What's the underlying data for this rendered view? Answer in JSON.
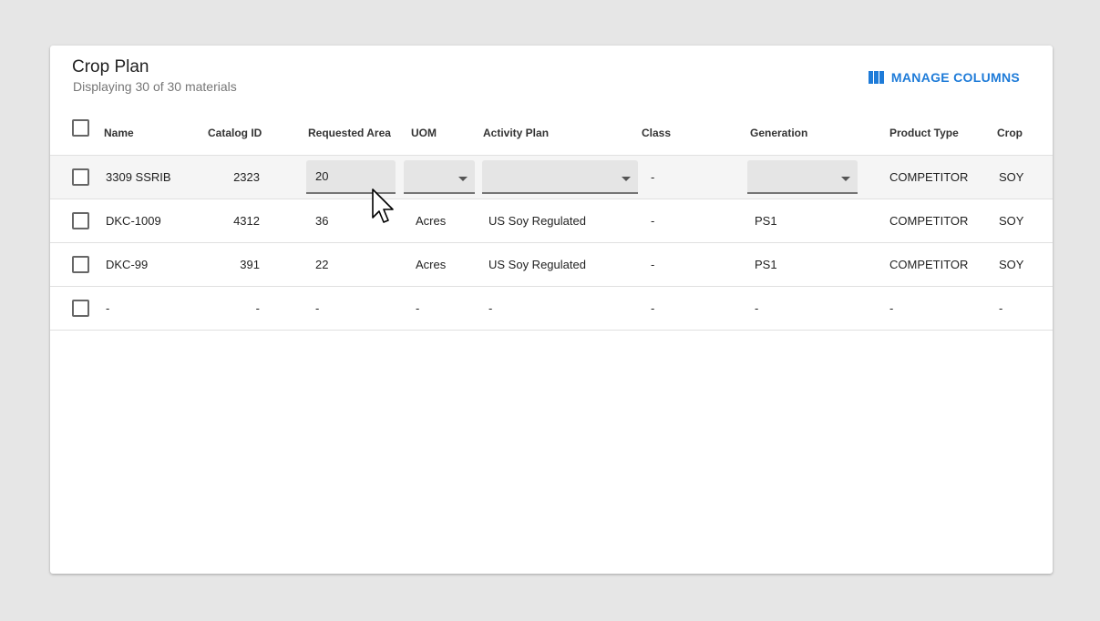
{
  "header": {
    "title": "Crop Plan",
    "subtitle": "Displaying 30 of 30 materials",
    "manage_columns_label": "MANAGE COLUMNS"
  },
  "columns": [
    "Name",
    "Catalog ID",
    "Requested Area",
    "UOM",
    "Activity Plan",
    "Class",
    "Generation",
    "Product Type",
    "Crop"
  ],
  "rows": [
    {
      "name": "3309 SSRIB",
      "catalog_id": "2323",
      "requested_area": "20",
      "uom": "",
      "activity_plan": "",
      "class": "-",
      "generation": "",
      "product_type": "COMPETITOR",
      "crop": "SOY",
      "editing": true
    },
    {
      "name": "DKC-1009",
      "catalog_id": "4312",
      "requested_area": "36",
      "uom": "Acres",
      "activity_plan": "US Soy Regulated",
      "class": "-",
      "generation": "PS1",
      "product_type": "COMPETITOR",
      "crop": "SOY"
    },
    {
      "name": "DKC-99",
      "catalog_id": "391",
      "requested_area": "22",
      "uom": "Acres",
      "activity_plan": "US Soy Regulated",
      "class": "-",
      "generation": "PS1",
      "product_type": "COMPETITOR",
      "crop": "SOY"
    },
    {
      "name": "-",
      "catalog_id": "-",
      "requested_area": "-",
      "uom": "-",
      "activity_plan": "-",
      "class": "-",
      "generation": "-",
      "product_type": "-",
      "crop": "-"
    }
  ],
  "icons": {
    "manage_columns": "view-column-icon",
    "cursor": "mouse-pointer-icon",
    "dropdown": "arrow-drop-down-icon"
  },
  "colors": {
    "accent": "#1e7bd8",
    "background": "#e6e6e6",
    "selected_row": "#f5f5f5"
  }
}
